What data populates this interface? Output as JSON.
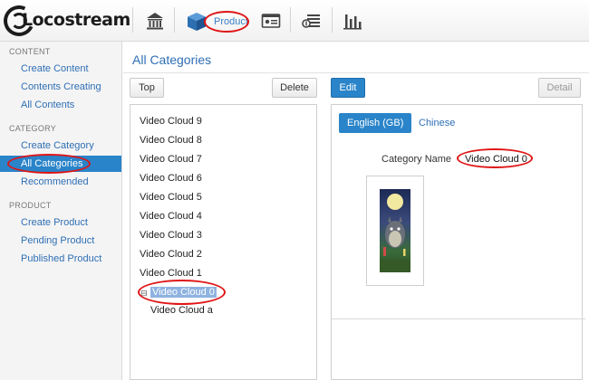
{
  "app": {
    "logo_text": "Locostream"
  },
  "topnav": {
    "product_label": "Product"
  },
  "sidebar": {
    "sections": [
      {
        "heading": "CONTENT",
        "items": [
          "Create Content",
          "Contents Creating",
          "All Contents"
        ]
      },
      {
        "heading": "CATEGORY",
        "items": [
          "Create Category",
          "All Categories",
          "Recommended"
        ]
      },
      {
        "heading": "PRODUCT",
        "items": [
          "Create Product",
          "Pending Product",
          "Published Product"
        ]
      }
    ],
    "active_item": "All Categories"
  },
  "main": {
    "title": "All Categories",
    "toolbar": {
      "top": "Top",
      "delete": "Delete",
      "edit": "Edit",
      "detail": "Detail"
    },
    "tree": {
      "items": [
        "Video Cloud 9",
        "Video Cloud 8",
        "Video Cloud 7",
        "Video Cloud 6",
        "Video Cloud 5",
        "Video Cloud 4",
        "Video Cloud 3",
        "Video Cloud 2",
        "Video Cloud 1"
      ],
      "toggle": "⊟",
      "selected": "Video Cloud 0",
      "child": "Video Cloud a"
    },
    "detail": {
      "tabs": [
        "English (GB)",
        "Chinese"
      ],
      "active_tab": "English (GB)",
      "category_name_label": "Category Name",
      "category_name_value": "Video Cloud 0"
    }
  },
  "colors": {
    "accent": "#2a84c9",
    "link": "#2f6fb5",
    "highlight_mark": "#e01515",
    "selection": "#8fb3e0"
  }
}
